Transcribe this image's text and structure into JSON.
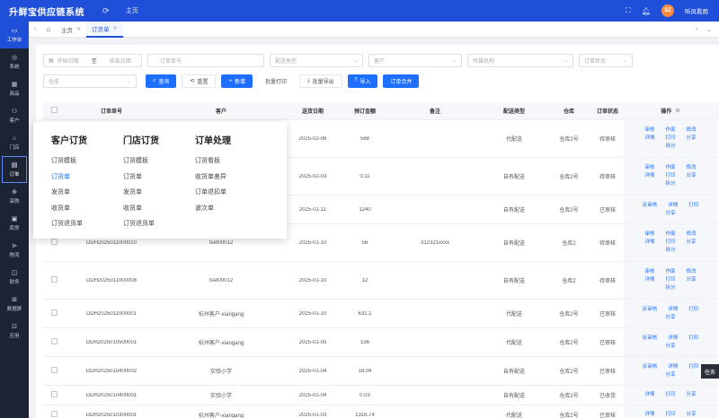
{
  "app": {
    "title": "升鲜宝供应链系统",
    "home": "主页",
    "user": "听风看雨",
    "avatar_text": "SZ",
    "brand_color": "#1f4fd8"
  },
  "sidebar": {
    "items": [
      {
        "label": "工作台",
        "icon": "monitor-icon"
      },
      {
        "label": "系统",
        "icon": "globe-icon"
      },
      {
        "label": "商品",
        "icon": "grid-icon"
      },
      {
        "label": "客户",
        "icon": "user-icon"
      },
      {
        "label": "门店",
        "icon": "store-icon"
      },
      {
        "label": "订单",
        "icon": "order-icon"
      },
      {
        "label": "采购",
        "icon": "purchase-icon"
      },
      {
        "label": "库房",
        "icon": "warehouse-icon"
      },
      {
        "label": "物流",
        "icon": "truck-icon"
      },
      {
        "label": "财务",
        "icon": "finance-icon"
      },
      {
        "label": "数据屏",
        "icon": "screen-icon"
      },
      {
        "label": "应用",
        "icon": "app-icon"
      }
    ]
  },
  "tabs": [
    {
      "label": "主页"
    },
    {
      "label": "订货单"
    }
  ],
  "filters": {
    "start_date": "开始日期",
    "date_sep": "至",
    "end_date": "结束日期",
    "order_no": "订单单号",
    "delivery_type": "配送类型",
    "customer": "客户",
    "org": "所属机构",
    "status": "订单状态",
    "warehouse": "仓库"
  },
  "buttons": {
    "query": "查询",
    "reset": "重置",
    "add": "新增",
    "batch_print": "批量打印",
    "batch_export": "批量导出",
    "import": "导入",
    "merge": "订单合并"
  },
  "table": {
    "headers": [
      "订单单号",
      "客户",
      "送货日期",
      "预订金额",
      "备注",
      "配送类型",
      "仓库",
      "订单状态",
      "操作"
    ],
    "rows": [
      {
        "no": "",
        "customer": "",
        "date": "2025-02-06",
        "amount": "568",
        "note": "",
        "type": "代配送",
        "wh": "仓库2号",
        "status": "待审核",
        "ops": [
          [
            "审核",
            "作废",
            "修改"
          ],
          [
            "详情",
            "打印",
            "分享"
          ],
          [
            "拆分"
          ]
        ]
      },
      {
        "no": "",
        "customer": "",
        "date": "2025-02-03",
        "amount": "0.11",
        "note": "",
        "type": "自有配送",
        "wh": "仓库2号",
        "status": "待审核",
        "ops": [
          [
            "审核",
            "作废",
            "修改"
          ],
          [
            "详情",
            "打印",
            "分享"
          ],
          [
            "拆分"
          ]
        ]
      },
      {
        "no": "",
        "customer": "",
        "date": "2025-01-11",
        "amount": "1240",
        "note": "",
        "type": "自有配送",
        "wh": "仓库2号",
        "status": "已审核",
        "ops": [
          [
            "反审核",
            "详情",
            "打印"
          ],
          [
            "分享"
          ]
        ]
      },
      {
        "no": "DDH2025011000010",
        "customer": "tset00012",
        "date": "2025-01-10",
        "amount": "56",
        "note": "312321xxxx",
        "type": "自有配送",
        "wh": "仓库2",
        "status": "待审核",
        "ops": [
          [
            "审核",
            "作废",
            "修改"
          ],
          [
            "详情",
            "打印",
            "分享"
          ],
          [
            "拆分"
          ]
        ]
      },
      {
        "no": "DDH2025011000008",
        "customer": "tset00012",
        "date": "2025-01-10",
        "amount": "12",
        "note": "",
        "type": "自有配送",
        "wh": "仓库2",
        "status": "待审核",
        "ops": [
          [
            "审核",
            "作废",
            "修改"
          ],
          [
            "详情",
            "打印",
            "分享"
          ],
          [
            "拆分"
          ]
        ]
      },
      {
        "no": "DDH2025011000001",
        "customer": "杭州客户-xiangang",
        "date": "2025-01-10",
        "amount": "631.1",
        "note": "",
        "type": "代配送",
        "wh": "仓库2号",
        "status": "已审核",
        "ops": [
          [
            "反审核",
            "详情",
            "打印"
          ],
          [
            "分享"
          ]
        ]
      },
      {
        "no": "DDH2025010500001",
        "customer": "杭州客户-xiangang",
        "date": "2025-01-05",
        "amount": "156",
        "note": "",
        "type": "代配送",
        "wh": "仓库2号",
        "status": "已审核",
        "ops": [
          [
            "反审核",
            "详情",
            "打印"
          ],
          [
            "分享"
          ]
        ]
      },
      {
        "no": "DDH2025010400002",
        "customer": "实验小学",
        "date": "2025-01-04",
        "amount": "18.04",
        "note": "",
        "type": "自有配送",
        "wh": "仓库2号",
        "status": "已审核",
        "ops": [
          [
            "反审核",
            "详情",
            "打印"
          ],
          [
            "分享"
          ]
        ]
      },
      {
        "no": "DDH2025010400001",
        "customer": "实验小学",
        "date": "2025-01-04",
        "amount": "0.03",
        "note": "",
        "type": "自有配送",
        "wh": "仓库2号",
        "status": "已收货",
        "ops": [
          [
            "详情",
            "打印",
            "分享"
          ]
        ]
      },
      {
        "no": "DDH2025010300001",
        "customer": "杭州客户-xiangang",
        "date": "2025-01-03",
        "amount": "1316.74",
        "note": "",
        "type": "代配送",
        "wh": "仓库2号",
        "status": "已审核",
        "ops": [
          [
            "详情",
            "打印",
            "分享"
          ]
        ]
      }
    ]
  },
  "menu": {
    "columns": [
      {
        "title": "客户订货",
        "items": [
          "订货模板",
          "订货单",
          "发货单",
          "收货单",
          "订货退货单"
        ]
      },
      {
        "title": "门店订货",
        "items": [
          "订货模板",
          "订货单",
          "发货单",
          "收货单",
          "订货退货单"
        ]
      },
      {
        "title": "订单处理",
        "items": [
          "订货看板",
          "收货单差异",
          "订单退扣单",
          "波次单"
        ]
      }
    ]
  },
  "floating_label": "任务"
}
